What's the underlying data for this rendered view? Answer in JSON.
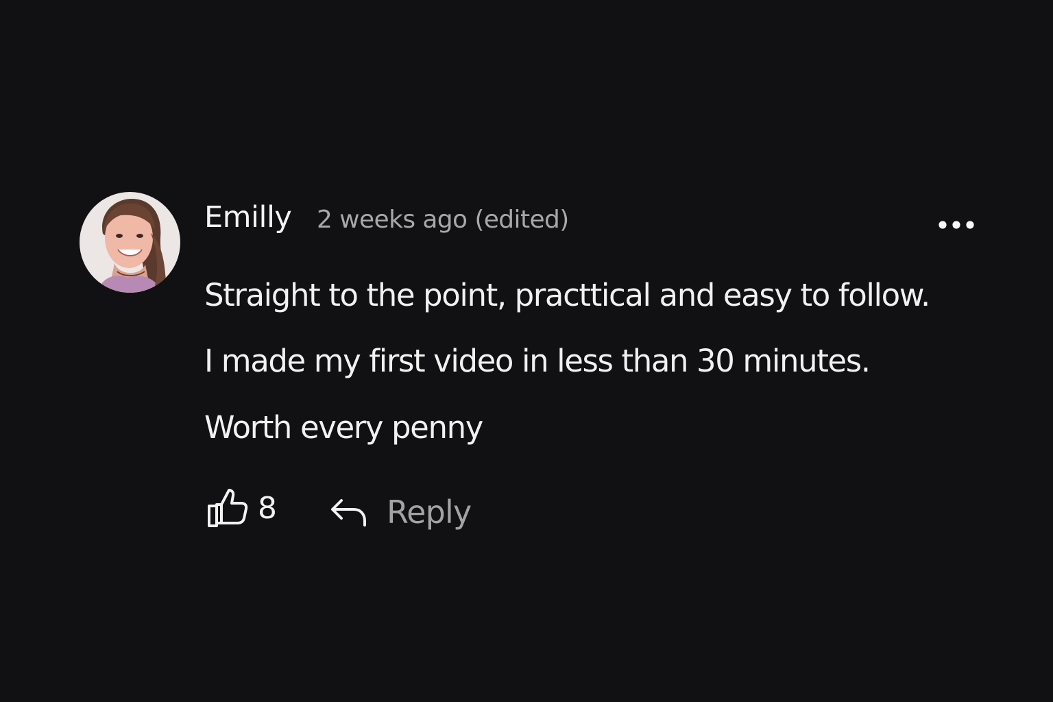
{
  "comment": {
    "author": "Emilly",
    "meta": "2 weeks ago (edited)",
    "avatar_icon": "user-avatar-photo",
    "more_icon": "more-horizontal-icon",
    "lines": [
      "Straight to the point, practtical and easy to follow.",
      "I made my first video in less than 30 minutes.",
      "Worth every penny"
    ],
    "like_icon": "thumbs-up-icon",
    "like_count": "8",
    "reply_icon": "reply-arrow-icon",
    "reply_label": "Reply"
  },
  "colors": {
    "background": "#111113",
    "primary_text": "#f2f2f2",
    "secondary_text": "#a8a8a8"
  }
}
